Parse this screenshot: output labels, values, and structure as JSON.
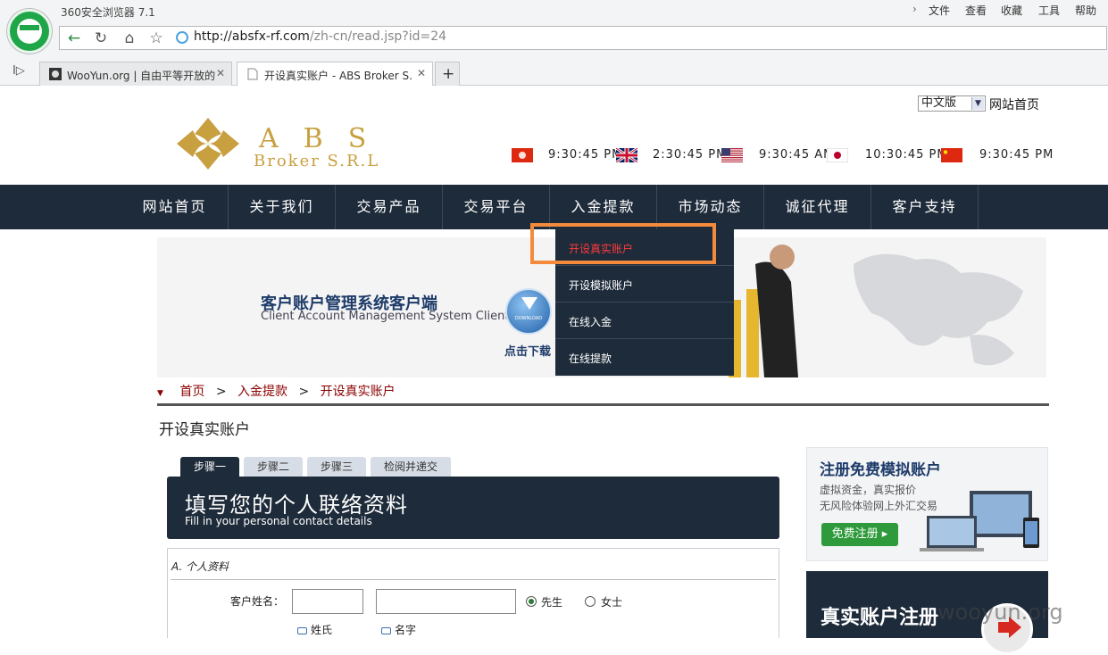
{
  "browser": {
    "app_title": "360安全浏览器 7.1",
    "menu": [
      "文件",
      "查看",
      "收藏",
      "工具",
      "帮助"
    ],
    "url_host": "http://absfx-rf.com",
    "url_path": "/zh-cn/read.jsp?id=24",
    "tabs": [
      {
        "label": "WooYun.org | 自由平等开放的",
        "active": false
      },
      {
        "label": "开设真实账户 - ABS Broker S.",
        "active": true
      }
    ],
    "new_tab": "+",
    "sidebar_toggle": "I▷"
  },
  "header": {
    "language_select": "中文版",
    "home_link": "网站首页",
    "brand_line1": "ABS",
    "brand_line2": "Broker S.R.L",
    "clocks": [
      "9:30:45 PM",
      "2:30:45 PM",
      "9:30:45 AM",
      "10:30:45 PM",
      "9:30:45 PM"
    ],
    "flags": [
      "hk-flag",
      "uk-flag",
      "us-flag",
      "jp-flag",
      "cn-flag"
    ]
  },
  "nav": {
    "items": [
      "网站首页",
      "关于我们",
      "交易产品",
      "交易平台",
      "入金提款",
      "市场动态",
      "诚征代理",
      "客户支持"
    ],
    "dropdown": [
      "开设真实账户",
      "开设模拟账户",
      "在线入金",
      "在线提款"
    ]
  },
  "banner": {
    "title": "客户账户管理系统客户端",
    "subtitle": "Client Account Management System Client",
    "download_badge": "DOWNLOAD",
    "download_label": "点击下载"
  },
  "breadcrumb": {
    "items": [
      "首页",
      "入金提款",
      "开设真实账户"
    ],
    "separator": ">"
  },
  "page_title": "开设真实账户",
  "steps": [
    "步骤一",
    "步骤二",
    "步骤三",
    "检阅并递交"
  ],
  "form": {
    "heading_zh": "填写您的个人联络资料",
    "heading_en": "Fill in your personal contact details",
    "section": "A. 个人资料",
    "name_label": "客户姓名：",
    "title_options": [
      "先生",
      "女士"
    ],
    "selected_title": "先生",
    "hint_surname": "姓氏",
    "hint_given": "名字"
  },
  "promo": {
    "demo_title": "注册免费模拟账户",
    "demo_line1": "虚拟资金，真实报价",
    "demo_line2": "无风险体验网上外汇交易",
    "demo_button": "免费注册",
    "real_title": "真实账户注册"
  },
  "watermark": "wooyun.org",
  "colors": {
    "nav_bg": "#1e2b3a",
    "brand_gold": "#c8a040",
    "highlight": "#f48a3c",
    "active_dropdown": "#ff3b3b"
  }
}
